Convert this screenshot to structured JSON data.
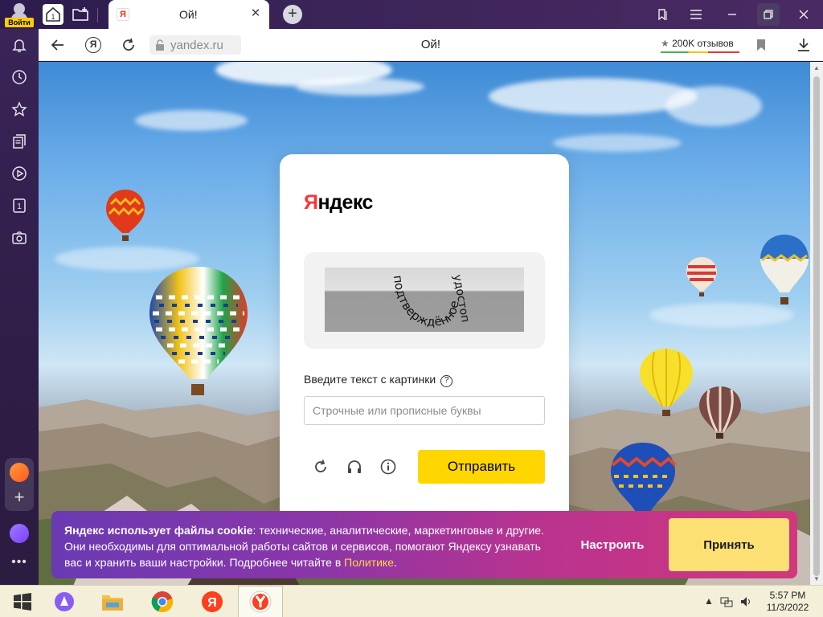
{
  "titlebar": {
    "login_label": "Войти",
    "home_tab_count": "1",
    "active_tab": {
      "title": "Ой!",
      "favicon": "Я",
      "close": "✕"
    },
    "new_tab": "+"
  },
  "addressbar": {
    "url": "yandex.ru",
    "page_title": "Ой!",
    "reviews": "200K отзывов",
    "reviews_star": "★"
  },
  "sidebar": {
    "tab_counter": "1",
    "more": "•••"
  },
  "captcha": {
    "logo_first": "Я",
    "logo_rest": "ндекс",
    "captcha_word_1": "подтверждённое",
    "captcha_word_2": "удостоп",
    "prompt": "Введите текст с картинки",
    "help": "?",
    "input_placeholder": "Строчные или прописные буквы",
    "input_value": "",
    "submit": "Отправить"
  },
  "cookie_banner": {
    "bold": "Яндекс использует файлы cookie",
    "text": ": технические, аналитические, маркетинговые и другие. Они необходимы для оптимальной работы сайтов и сервисов, помогают Яндексу узнавать вас и хранить ваши настройки. Подробнее читайте в ",
    "link": "Политике",
    "end": ".",
    "settings": "Настроить",
    "accept": "Принять"
  },
  "taskbar": {
    "time": "5:57 PM",
    "date": "11/3/2022"
  },
  "colors": {
    "yandex_yellow": "#ffd600",
    "yandex_red": "#ff3333",
    "sidebar_bg": "#2e1d46"
  }
}
